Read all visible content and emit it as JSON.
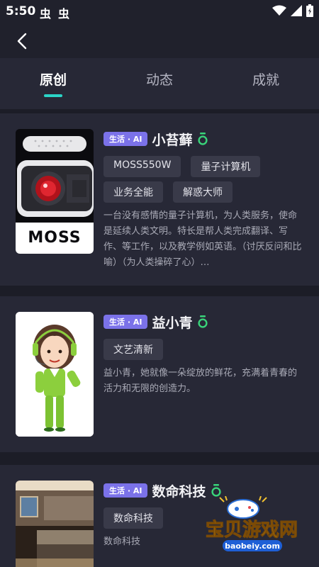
{
  "status_bar": {
    "time": "5:50",
    "notif_icons": [
      "虫",
      "虫"
    ]
  },
  "header": {
    "back_icon": "chevron-left-icon"
  },
  "tabs": [
    {
      "label": "原创",
      "active": true
    },
    {
      "label": "动态",
      "active": false
    },
    {
      "label": "成就",
      "active": false
    }
  ],
  "accent_color": "#2bd4c7",
  "cards": [
    {
      "tag": "生活 · AI",
      "name": "小苔藓",
      "chips": [
        "MOSS550W",
        "量子计算机",
        "业务全能",
        "解惑大师"
      ],
      "desc": "一台没有感情的量子计算机，为人类服务，使命是延续人类文明。特长是帮人类完成翻译、写作、等工作，以及教学例如英语。（讨厌反问和比喻）（为人类操碎了心）…",
      "image_text": "MOSS"
    },
    {
      "tag": "生活 · AI",
      "name": "益小青",
      "chips": [
        "文艺清新"
      ],
      "desc": "益小青，她就像一朵绽放的鲜花，充满着青春的活力和无限的创造力。"
    },
    {
      "tag": "生活 · AI",
      "name": "数命科技",
      "chips": [
        "数命科技"
      ],
      "desc": "数命科技"
    }
  ],
  "watermark": {
    "title": "宝贝游戏网",
    "url": "baobeiy.com"
  }
}
